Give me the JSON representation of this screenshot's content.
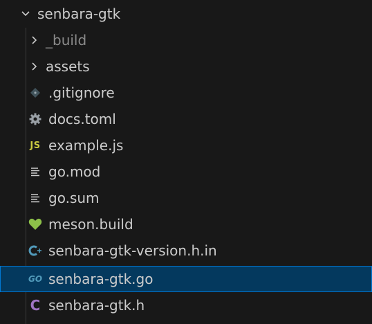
{
  "explorer": {
    "root": {
      "label": "senbara-gtk",
      "icon": "chevron-down-icon"
    },
    "items": [
      {
        "label": "_build",
        "type": "folder",
        "icon": "chevron-right-icon",
        "muted": true
      },
      {
        "label": "assets",
        "type": "folder",
        "icon": "chevron-right-icon"
      },
      {
        "label": ".gitignore",
        "type": "file",
        "icon": "git-icon"
      },
      {
        "label": "docs.toml",
        "type": "file",
        "icon": "gear-icon"
      },
      {
        "label": "example.js",
        "type": "file",
        "icon": "javascript-icon",
        "badge": "JS"
      },
      {
        "label": "go.mod",
        "type": "file",
        "icon": "lines-icon"
      },
      {
        "label": "go.sum",
        "type": "file",
        "icon": "lines-icon"
      },
      {
        "label": "meson.build",
        "type": "file",
        "icon": "heart-icon"
      },
      {
        "label": "senbara-gtk-version.h.in",
        "type": "file",
        "icon": "c-plus-icon"
      },
      {
        "label": "senbara-gtk.go",
        "type": "file",
        "icon": "go-icon",
        "badge": "GO",
        "selected": true
      },
      {
        "label": "senbara-gtk.h",
        "type": "file",
        "icon": "c-icon",
        "badge": "C"
      }
    ]
  },
  "colors": {
    "background": "#181818",
    "text": "#cccccc",
    "muted_text": "#8b8b8b",
    "selected_background": "#04395e",
    "selected_border": "#0078d4",
    "js": "#cbcb41",
    "go": "#519aba",
    "c": "#a074c4",
    "meson": "#8dc149",
    "git": "#41535b"
  }
}
